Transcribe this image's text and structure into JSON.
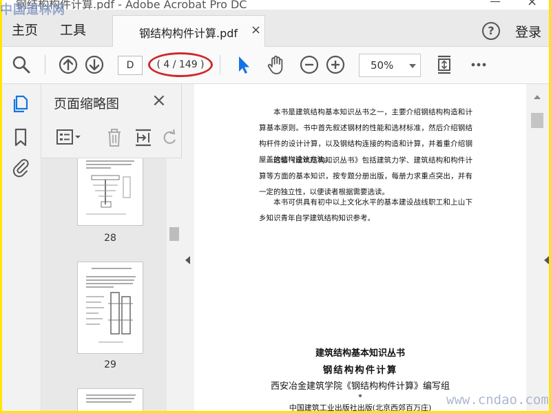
{
  "window": {
    "title": "钢结构构件计算.pdf - Adobe Acrobat Pro DC",
    "watermark_top": "中国道林网",
    "watermark_bottom": "www.cndao.com"
  },
  "nav": {
    "home": "主页",
    "tools": "工具",
    "doc_tab": "钢结构构件计算.pdf",
    "doc_tab_close": "×",
    "help": "?",
    "sign_in": "登录"
  },
  "toolbar": {
    "page_input": "D",
    "page_count": "( 4 / 149 )",
    "zoom": "50%"
  },
  "panel": {
    "title": "页面缩略图",
    "close": "×",
    "thumbnails": [
      {
        "page": "28"
      },
      {
        "page": "29"
      }
    ]
  },
  "document": {
    "paragraphs": [
      "本书是建筑结构基本知识丛书之一，主要介绍钢结构构造和计算基本原则。书中首先叙述钢材的性能和选材标准，然后介绍钢结构杆件的设计计算，以及钢结构连接的构造和计算，并着重介绍钢屋盖的结构设计方法。",
      "这套《建筑结构知识丛书》包括建筑力学、建筑结构和构件计算等方面的基本知识，按专题分册出版，每册力求重点突出，并有一定的独立性，以便读者根据需要选读。",
      "本书可供具有初中以上文化水平的基本建设战线职工和上山下乡知识青年自学建筑结构知识参考。"
    ],
    "credits": {
      "series": "建筑结构基本知识丛书",
      "title": "钢结构构件计算",
      "author": "西安冶金建筑学院《钢结构构件计算》编写组",
      "star": "*",
      "publisher": "中国建筑工业出版社出版(北京西郊百万庄)"
    }
  },
  "colors": {
    "highlight_ring": "#d0282a",
    "select_tool": "#1473e6",
    "page_frame": "#ffe600"
  }
}
